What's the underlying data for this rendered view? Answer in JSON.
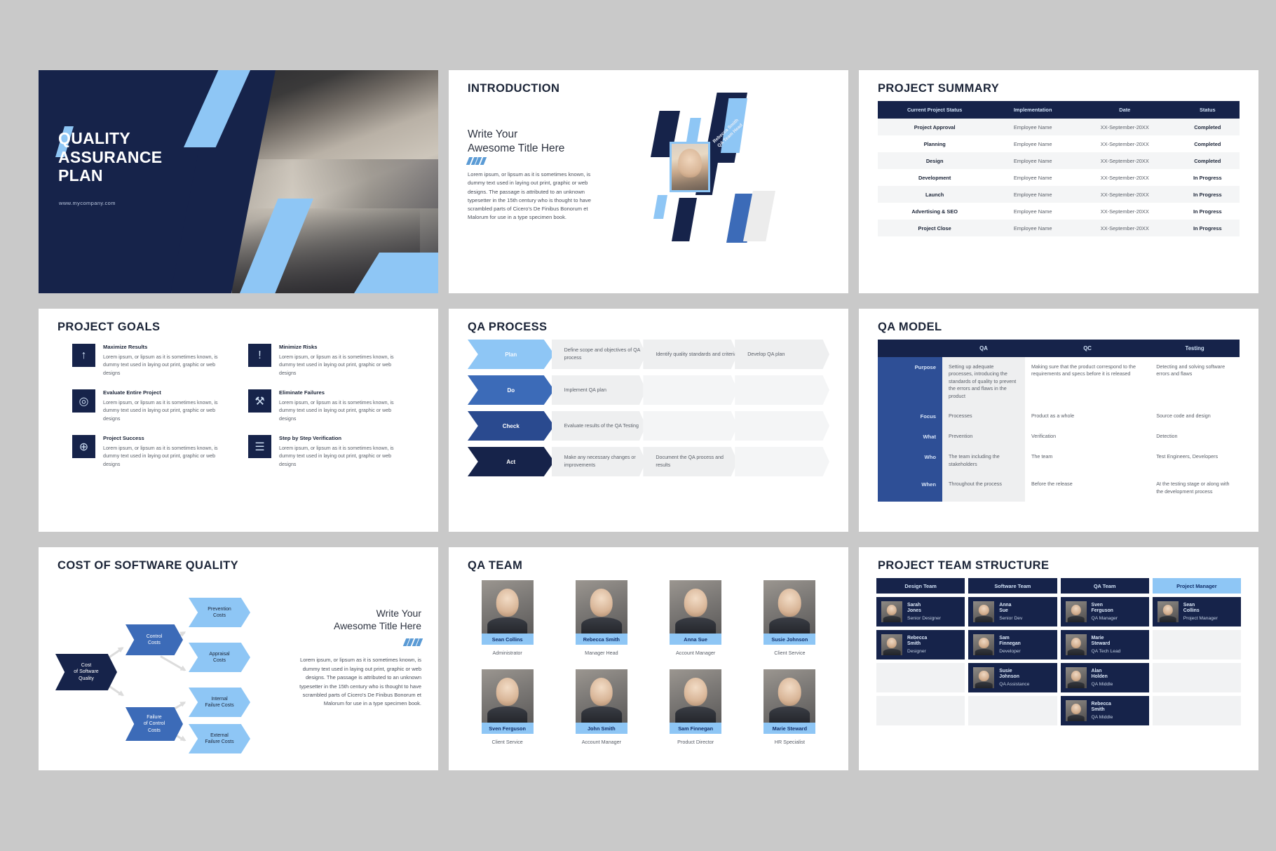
{
  "cover": {
    "title_lines": [
      "QUALITY",
      "ASSURANCE",
      "PLAN"
    ],
    "url": "www.mycompany.com"
  },
  "introduction": {
    "heading": "INTRODUCTION",
    "title_lines": [
      "Write Your",
      "Awesome Title Here"
    ],
    "body": "Lorem ipsum, or lipsum as it is sometimes known, is dummy text used in laying out print, graphic or web designs. The passage is attributed to an unknown typesetter in the 15th century who is thought to have scrambled parts of Cicero's De Finibus Bonorum et Malorum for use in a type specimen book.",
    "photo_caption": "Rebecca Smith\nQA Team Head",
    "photo_caption_name": "Rebecca Smith",
    "photo_caption_role": "QA Team Head"
  },
  "project_summary": {
    "heading": "PROJECT SUMMARY",
    "columns": [
      "Current Project Status",
      "Implementation",
      "Date",
      "Status"
    ],
    "rows": [
      [
        "Project Approval",
        "Employee Name",
        "XX-September-20XX",
        "Completed"
      ],
      [
        "Planning",
        "Employee Name",
        "XX-September-20XX",
        "Completed"
      ],
      [
        "Design",
        "Employee Name",
        "XX-September-20XX",
        "Completed"
      ],
      [
        "Development",
        "Employee Name",
        "XX-September-20XX",
        "In Progress"
      ],
      [
        "Launch",
        "Employee Name",
        "XX-September-20XX",
        "In Progress"
      ],
      [
        "Advertising & SEO",
        "Employee Name",
        "XX-September-20XX",
        "In Progress"
      ],
      [
        "Project Close",
        "Employee Name",
        "XX-September-20XX",
        "In Progress"
      ]
    ]
  },
  "project_goals": {
    "heading": "PROJECT GOALS",
    "body_text": "Lorem ipsum, or lipsum as it is sometimes known, is dummy text used in laying out print, graphic or web designs",
    "items": [
      {
        "title": "Maximize Results",
        "icon": "rocket-icon",
        "glyph": "↑"
      },
      {
        "title": "Minimize Risks",
        "icon": "alert-circle-icon",
        "glyph": "!"
      },
      {
        "title": "Evaluate Entire Project",
        "icon": "folder-search-icon",
        "glyph": "◎"
      },
      {
        "title": "Eliminate Failures",
        "icon": "wrench-icon",
        "glyph": "⚒"
      },
      {
        "title": "Project Success",
        "icon": "target-icon",
        "glyph": "⊕"
      },
      {
        "title": "Step by Step Verification",
        "icon": "checklist-icon",
        "glyph": "☰"
      }
    ]
  },
  "qa_process": {
    "heading": "QA PROCESS",
    "steps": [
      {
        "label": "Plan",
        "detail1": "Define scope and objectives of QA process",
        "detail2": "Identify quality standards and criteria",
        "detail3": "Develop QA plan"
      },
      {
        "label": "Do",
        "detail1": "Implement QA plan",
        "detail2": "",
        "detail3": ""
      },
      {
        "label": "Check",
        "detail1": "Evaluate results of the QA Testing",
        "detail2": "",
        "detail3": ""
      },
      {
        "label": "Act",
        "detail1": "Make any necessary changes or improvements",
        "detail2": "Document the QA process and results",
        "detail3": ""
      }
    ]
  },
  "qa_model": {
    "heading": "QA MODEL",
    "columns": [
      "",
      "QA",
      "QC",
      "Testing"
    ],
    "rows": [
      {
        "label": "Purpose",
        "qa": "Setting up adequate processes, introducing the standards of quality to prevent the errors and flaws in the product",
        "qc": "Making sure that the product correspond to the requirements and specs before it is released",
        "testing": "Detecting and solving software errors and flaws"
      },
      {
        "label": "Focus",
        "qa": "Processes",
        "qc": "Product as a whole",
        "testing": "Source code and design"
      },
      {
        "label": "What",
        "qa": "Prevention",
        "qc": "Verification",
        "testing": "Detection"
      },
      {
        "label": "Who",
        "qa": "The team including the stakeholders",
        "qc": "The team",
        "testing": "Test Engineers, Developers"
      },
      {
        "label": "When",
        "qa": "Throughout the process",
        "qc": "Before the release",
        "testing": "At the testing stage or along with the development process"
      }
    ]
  },
  "cost_quality": {
    "heading": "COST OF SOFTWARE QUALITY",
    "root": "Cost\nof Software\nQuality",
    "nodes": {
      "root": "Cost of Software Quality",
      "control": "Control Costs",
      "failure": "Failure of Control Costs",
      "prevention": "Prevention Costs",
      "appraisal": "Appraisal Costs",
      "internal": "Internal Failure Costs",
      "external": "External Failure Costs"
    },
    "title_lines": [
      "Write Your",
      "Awesome Title Here"
    ],
    "body": "Lorem ipsum, or lipsum as it is sometimes known, is dummy text used in laying out print, graphic or web designs. The passage is attributed to an unknown typesetter in the 15th century who is thought to have scrambled parts of Cicero's De Finibus Bonorum et Malorum for use in a type specimen book."
  },
  "qa_team": {
    "heading": "QA TEAM",
    "members": [
      {
        "name": "Sean Collins",
        "role": "Administrator"
      },
      {
        "name": "Rebecca Smith",
        "role": "Manager Head"
      },
      {
        "name": "Anna Sue",
        "role": "Account Manager"
      },
      {
        "name": "Susie Johnson",
        "role": "Client Service"
      },
      {
        "name": "Sven Ferguson",
        "role": "Client Service"
      },
      {
        "name": "John Smith",
        "role": "Account Manager"
      },
      {
        "name": "Sam Finnegan",
        "role": "Product Director"
      },
      {
        "name": "Marie Steward",
        "role": "HR Specialist"
      }
    ]
  },
  "team_structure": {
    "heading": "PROJECT TEAM STRUCTURE",
    "columns": [
      {
        "title": "Design Team",
        "members": [
          {
            "name": "Sarah Jones",
            "role": "Senior Designer"
          },
          {
            "name": "Rebecca Smith",
            "role": "Designer"
          }
        ]
      },
      {
        "title": "Software Team",
        "members": [
          {
            "name": "Anna Sue",
            "role": "Senior Dev"
          },
          {
            "name": "Sam Finnegan",
            "role": "Developer"
          },
          {
            "name": "Susie Johnson",
            "role": "QA Assistance"
          }
        ]
      },
      {
        "title": "QA Team",
        "members": [
          {
            "name": "Sven Ferguson",
            "role": "QA Manager"
          },
          {
            "name": "Marie Steward",
            "role": "QA Tech Lead"
          },
          {
            "name": "Alan Holden",
            "role": "QA Middle"
          },
          {
            "name": "Rebecca Smith",
            "role": "QA Middle"
          }
        ]
      },
      {
        "title": "Project Manager",
        "members": [
          {
            "name": "Sean Collins",
            "role": "Project Manager"
          }
        ]
      }
    ]
  },
  "colors": {
    "navy": "#16234a",
    "blue": "#3c6bb8",
    "light_blue": "#8ec6f5",
    "mid_blue": "#2a4a8f",
    "grey_row": "#eeeff0",
    "background": "#c9c9c9"
  }
}
